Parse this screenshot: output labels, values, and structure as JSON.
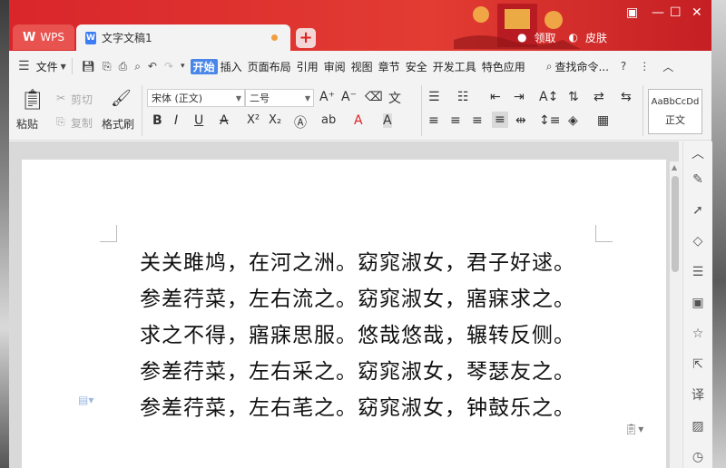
{
  "tabs": {
    "app": "WPS",
    "document": "文字文稿1"
  },
  "titlebar": {
    "user": "领取",
    "skin": "皮肤"
  },
  "menu": {
    "file": "文件",
    "items": [
      "开始",
      "插入",
      "页面布局",
      "引用",
      "审阅",
      "视图",
      "章节",
      "安全",
      "开发工具",
      "特色应用"
    ],
    "search": "查找命令..."
  },
  "ribbon": {
    "paste": "粘贴",
    "cut": "剪切",
    "copy": "复制",
    "format_painter": "格式刷",
    "font_name": "宋体 (正文)",
    "font_size": "二号",
    "style_preview": "AaBbCcDd",
    "style_name": "正文"
  },
  "document": {
    "lines": [
      "关关雎鸠，在河之洲。窈窕淑女，君子好逑。",
      "参差荇菜，左右流之。窈窕淑女，寤寐求之。",
      "求之不得，寤寐思服。悠哉悠哉，辗转反侧。",
      "参差荇菜，左右采之。窈窕淑女，琴瑟友之。",
      "参差荇菜，左右芼之。窈窕淑女，钟鼓乐之。"
    ]
  },
  "colors": {
    "titlebar": "#d9262b",
    "accent": "#4a86e8"
  }
}
